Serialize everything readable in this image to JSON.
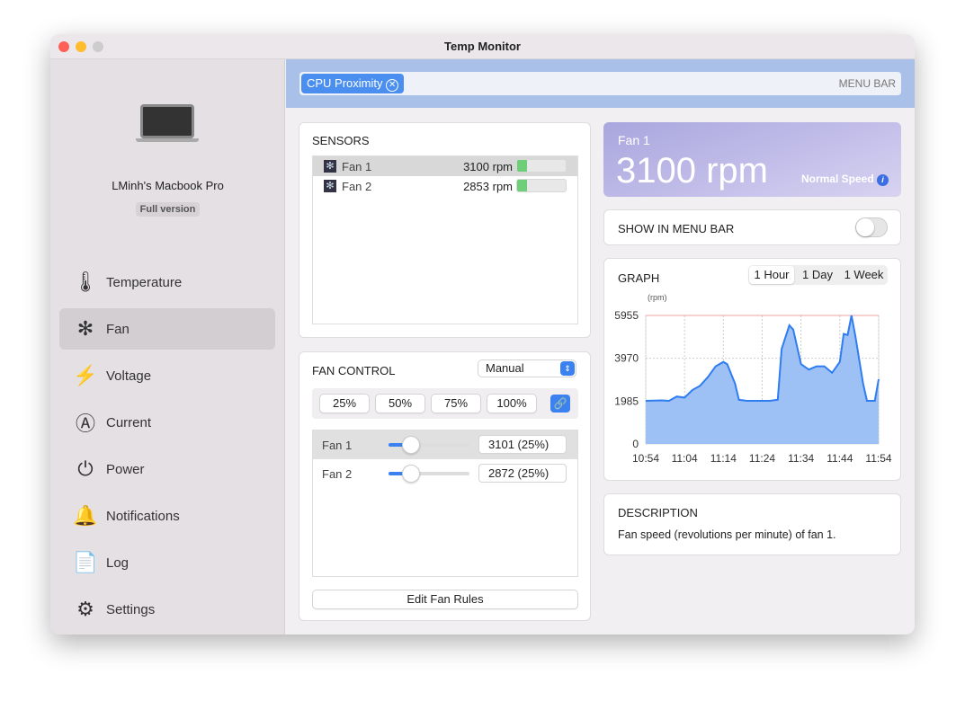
{
  "window": {
    "title": "Temp Monitor"
  },
  "device": {
    "name": "LMinh's Macbook Pro",
    "badge": "Full version"
  },
  "sidebar": {
    "items": [
      {
        "label": "Temperature",
        "icon": "thermometer-icon",
        "glyph": "🌡"
      },
      {
        "label": "Fan",
        "icon": "fan-icon",
        "glyph": "✻"
      },
      {
        "label": "Voltage",
        "icon": "bolt-icon",
        "glyph": "⚡"
      },
      {
        "label": "Current",
        "icon": "ampere-icon",
        "glyph": "Ⓐ"
      },
      {
        "label": "Power",
        "icon": "plug-icon",
        "glyph": "⏻"
      },
      {
        "label": "Notifications",
        "icon": "bell-icon",
        "glyph": "🔔"
      },
      {
        "label": "Log",
        "icon": "log-file-icon",
        "glyph": "📄"
      },
      {
        "label": "Settings",
        "icon": "gear-icon",
        "glyph": "⚙"
      }
    ],
    "selected": "Fan"
  },
  "search": {
    "chip": "CPU Proximity",
    "right_label": "MENU BAR"
  },
  "sensors": {
    "title": "SENSORS",
    "rows": [
      {
        "name": "Fan 1",
        "value": "3100 rpm",
        "fill": 0.2
      },
      {
        "name": "Fan 2",
        "value": "2853 rpm",
        "fill": 0.2
      }
    ]
  },
  "fan_control": {
    "title": "FAN CONTROL",
    "mode": "Manual",
    "presets": [
      "25%",
      "50%",
      "75%",
      "100%"
    ],
    "fans": [
      {
        "name": "Fan 1",
        "value": "3101 (25%)",
        "level": 0.25
      },
      {
        "name": "Fan 2",
        "value": "2872 (25%)",
        "level": 0.25
      }
    ],
    "edit_label": "Edit Fan Rules"
  },
  "header": {
    "name": "Fan 1",
    "value": "3100 rpm",
    "status": "Normal Speed"
  },
  "menu_bar": {
    "label": "SHOW IN MENU BAR",
    "on": false
  },
  "graph": {
    "title": "GRAPH",
    "ranges": [
      "1 Hour",
      "1 Day",
      "1 Week"
    ],
    "selected": "1 Hour"
  },
  "chart_data": {
    "type": "area",
    "ylabel": "(rpm)",
    "ylim": [
      0,
      5955
    ],
    "yticks": [
      "0",
      "1985",
      "3970",
      "5955"
    ],
    "xticks": [
      "10:54",
      "11:04",
      "11:14",
      "11:24",
      "11:34",
      "11:44",
      "11:54"
    ],
    "grid": true,
    "max_line": 5955,
    "color": "#2f7df0",
    "x": [
      "10:54",
      "10:58",
      "11:00",
      "11:02",
      "11:04",
      "11:06",
      "11:08",
      "11:10",
      "11:12",
      "11:14",
      "11:15",
      "11:17",
      "11:18",
      "11:20",
      "11:26",
      "11:28",
      "11:29",
      "11:31",
      "11:32",
      "11:34",
      "11:36",
      "11:38",
      "11:40",
      "11:42",
      "11:44",
      "11:45",
      "11:46",
      "11:47",
      "11:48",
      "11:50",
      "11:51",
      "11:53",
      "11:54"
    ],
    "values": [
      2000,
      2020,
      2000,
      2200,
      2150,
      2500,
      2700,
      3100,
      3600,
      3800,
      3700,
      2800,
      2050,
      2000,
      2000,
      2050,
      4400,
      5500,
      5300,
      3700,
      3450,
      3600,
      3600,
      3300,
      3800,
      5100,
      5050,
      5955,
      5000,
      2800,
      2000,
      2000,
      3000
    ]
  },
  "description": {
    "title": "DESCRIPTION",
    "text": "Fan speed (revolutions per minute) of fan 1."
  }
}
